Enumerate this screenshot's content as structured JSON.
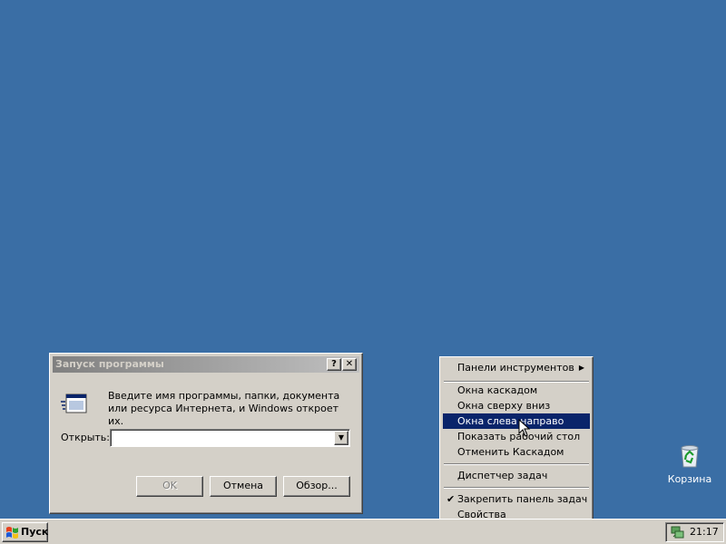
{
  "desktop": {
    "background_color": "#3a6ea5",
    "recycle_bin_label": "Корзина"
  },
  "run_dialog": {
    "title": "Запуск программы",
    "help_glyph": "?",
    "close_glyph": "✕",
    "description": "Введите имя программы, папки, документа или ресурса Интернета, и Windows откроет их.",
    "open_label": "Открыть:",
    "open_value": "",
    "ok_label": "OK",
    "cancel_label": "Отмена",
    "browse_label": "Обзор..."
  },
  "context_menu": {
    "items": [
      {
        "label": "Панели инструментов",
        "submenu": true
      },
      {
        "label": "Окна каскадом"
      },
      {
        "label": "Окна сверху вниз"
      },
      {
        "label": "Окна слева направо",
        "highlighted": true
      },
      {
        "label": "Показать рабочий стол"
      },
      {
        "label": "Отменить Каскадом"
      },
      {
        "label": "Диспетчер задач"
      },
      {
        "label": "Закрепить панель задач",
        "checked": true
      },
      {
        "label": "Свойства"
      }
    ],
    "highlight_color": "#0a246a"
  },
  "taskbar": {
    "start_label": "Пуск",
    "clock": "21:17"
  },
  "icons": {
    "run": "run-program-icon",
    "recycle": "recycle-bin-icon",
    "windows": "windows-flag-icon",
    "network": "network-tray-icon"
  }
}
